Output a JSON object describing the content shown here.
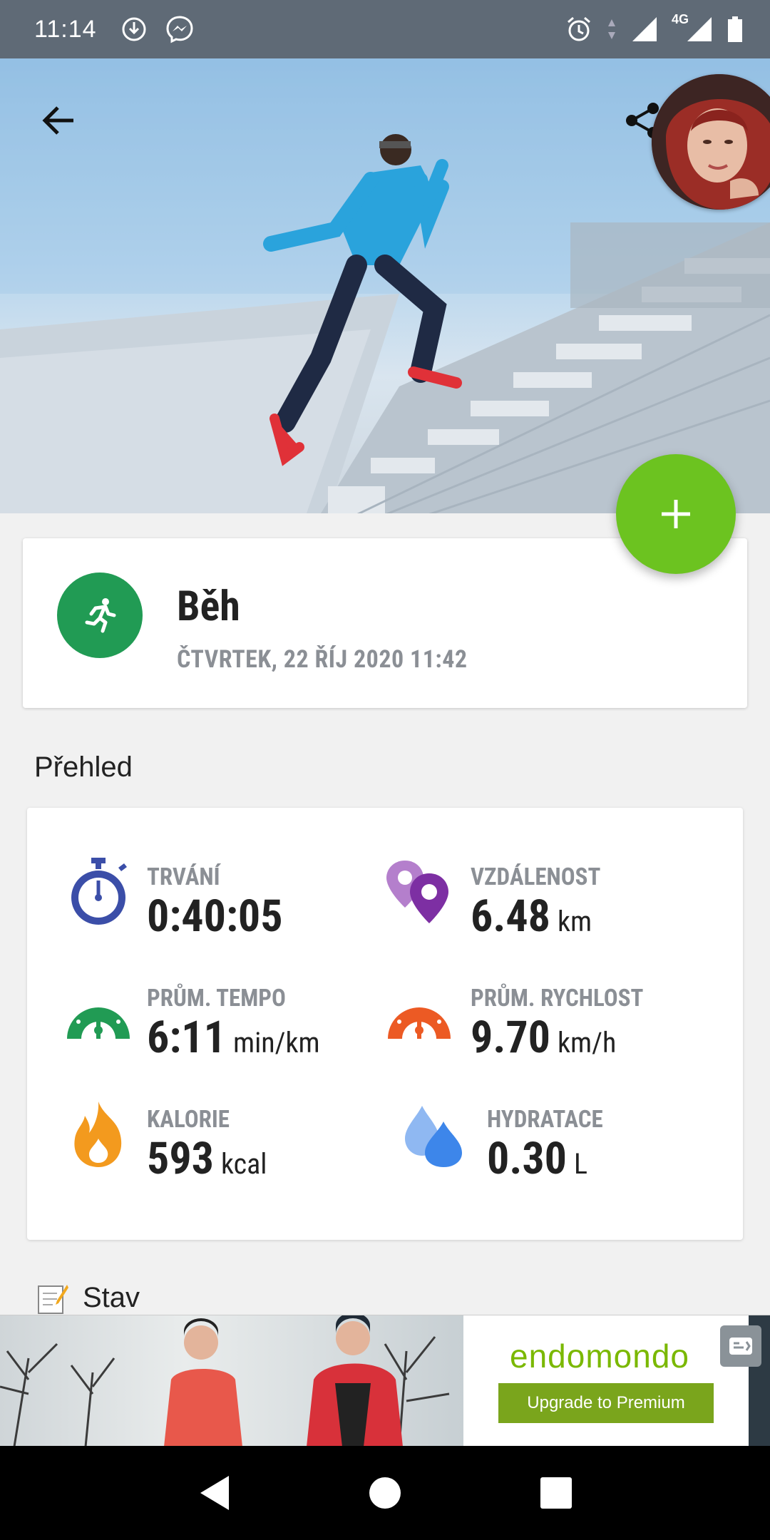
{
  "status_bar": {
    "time": "11:14",
    "network": "4G",
    "icons_left": [
      "download-icon",
      "messenger-icon"
    ],
    "icons_right": [
      "alarm-icon",
      "data-arrows-icon",
      "signal-icon",
      "signal-4g-icon",
      "battery-icon"
    ]
  },
  "header": {
    "back_icon": "arrow-left-icon",
    "share_icon": "share-icon"
  },
  "fab": {
    "icon": "plus-icon",
    "color": "#6cc320"
  },
  "activity": {
    "title": "Běh",
    "date": "ČTVRTEK, 22 ŘÍJ 2020 11:42",
    "icon": "running-icon",
    "icon_color": "#219b54"
  },
  "overview": {
    "title": "Přehled",
    "stats": [
      {
        "label": "TRVÁNÍ",
        "value": "0:40:05",
        "unit": "",
        "icon": "stopwatch-icon",
        "color": "#3b4ea8"
      },
      {
        "label": "VZDÁLENOST",
        "value": "6.48",
        "unit": "km",
        "icon": "location-pins-icon",
        "color": "#8e3fb1"
      },
      {
        "label": "PRŮM. TEMPO",
        "value": "6:11",
        "unit": "min/km",
        "icon": "pace-gauge-icon",
        "color": "#219b54"
      },
      {
        "label": "PRŮM. RYCHLOST",
        "value": "9.70",
        "unit": "km/h",
        "icon": "speed-gauge-icon",
        "color": "#ec5a24"
      },
      {
        "label": "KALORIE",
        "value": "593",
        "unit": "kcal",
        "icon": "flame-icon",
        "color": "#f39a1e"
      },
      {
        "label": "HYDRATACE",
        "value": "0.30",
        "unit": "L",
        "icon": "water-drops-icon",
        "color": "#4a8fe8"
      }
    ]
  },
  "status_section": {
    "label": "Stav",
    "icon": "note-edit-icon"
  },
  "ad": {
    "brand": "endomondo",
    "button_label": "Upgrade to Premium",
    "button_color": "#7aa51c"
  },
  "nav": {
    "icons": [
      "nav-back-icon",
      "nav-home-icon",
      "nav-recents-icon"
    ]
  }
}
